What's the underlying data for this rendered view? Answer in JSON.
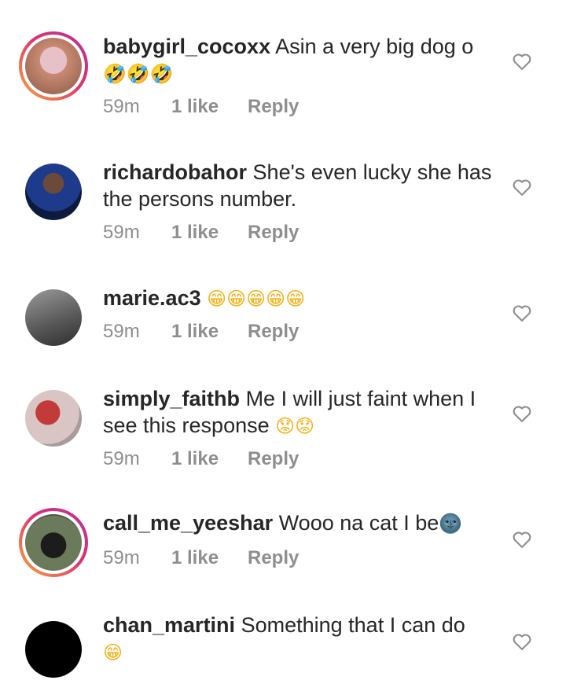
{
  "comments": [
    {
      "username": "babygirl_cocoxx",
      "text": "Asin a very big dog o",
      "emojis": "🤣🤣🤣",
      "time": "59m",
      "likes": "1 like",
      "reply": "Reply",
      "story_ring": true,
      "avatar_colors": [
        "#c98a73",
        "#e6c1c8"
      ]
    },
    {
      "username": "richardobahor",
      "text": "She's even lucky she has the persons number.",
      "emojis": "",
      "time": "59m",
      "likes": "1 like",
      "reply": "Reply",
      "story_ring": false,
      "avatar_colors": [
        "#1a2f6a",
        "#0b1a3d"
      ]
    },
    {
      "username": "marie.ac3",
      "text": "",
      "emojis": "😁😁😁😁😁",
      "time": "59m",
      "likes": "1 like",
      "reply": "Reply",
      "story_ring": false,
      "avatar_colors": [
        "#7d7d7d",
        "#3e3e3e"
      ]
    },
    {
      "username": "simply_faithb",
      "text": "Me I will just faint when I see this response",
      "emojis": "😟😟",
      "time": "59m",
      "likes": "1 like",
      "reply": "Reply",
      "story_ring": false,
      "avatar_colors": [
        "#d9c5c3",
        "#9c2b2b"
      ]
    },
    {
      "username": "call_me_yeeshar",
      "text": "Wooo na cat I be",
      "emojis": "🌚",
      "time": "59m",
      "likes": "1 like",
      "reply": "Reply",
      "story_ring": true,
      "avatar_colors": [
        "#6b7a5a",
        "#2a2a2a"
      ]
    },
    {
      "username": "chan_martini",
      "text": "Something that I can do",
      "emojis": "😁",
      "time": "59m",
      "likes": "1 like",
      "reply": "Reply",
      "story_ring": false,
      "avatar_colors": [
        "#000000",
        "#000000"
      ]
    }
  ]
}
